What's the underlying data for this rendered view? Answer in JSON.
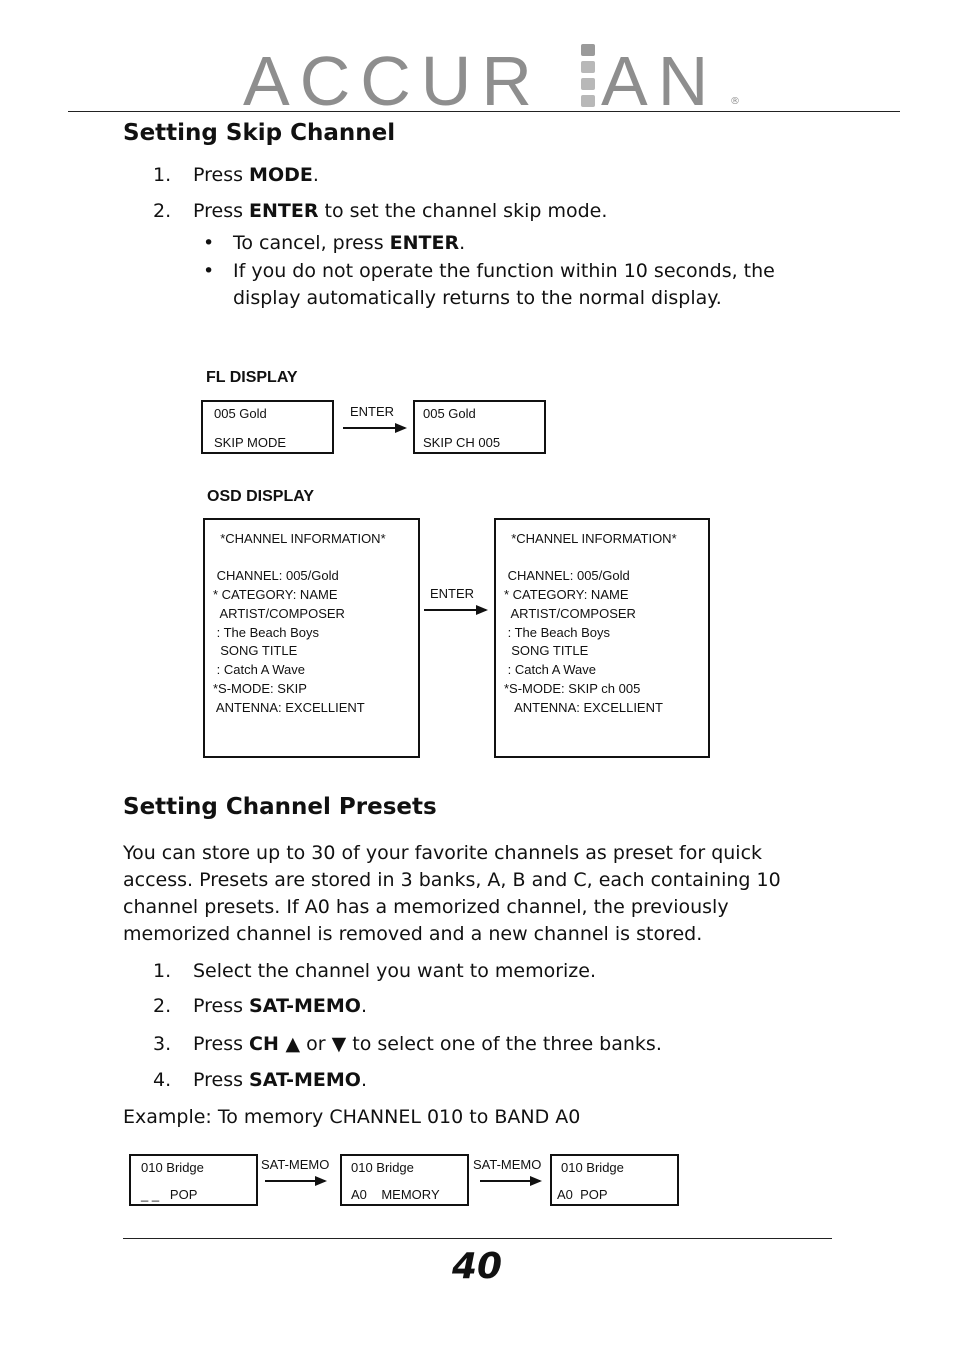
{
  "brand": {
    "name": "ACCUR",
    "name_tail": "AN",
    "registered": "®",
    "bar_colors": [
      "#9a9a9a",
      "#b8b8b8",
      "#b8b8b8",
      "#b8b8b8"
    ]
  },
  "section1": {
    "title": "Setting Skip Channel",
    "steps": [
      {
        "num": "1.",
        "pre": "Press ",
        "bold": "MODE",
        "post": "."
      },
      {
        "num": "2.",
        "pre": "Press ",
        "bold": "ENTER",
        "post": " to set the channel skip mode."
      }
    ],
    "bullets": [
      {
        "pre": "To cancel, press ",
        "bold": "ENTER",
        "post": "."
      },
      {
        "pre": "If you do not operate the function within 10 seconds, the display automatically returns to the normal display.",
        "bold": "",
        "post": ""
      }
    ],
    "bullet_char": "•",
    "fl_display": {
      "label": "FL DISPLAY",
      "arrow_label": "ENTER",
      "before": [
        "005 Gold",
        "SKIP MODE"
      ],
      "after": [
        "005 Gold",
        "SKIP CH 005"
      ]
    },
    "osd_display": {
      "label": "OSD DISPLAY",
      "arrow_label": "ENTER",
      "before": [
        "  *CHANNEL INFORMATION*",
        "",
        " CHANNEL: 005/Gold",
        "* CATEGORY: NAME",
        "  ARTIST/COMPOSER",
        " : The Beach Boys",
        "  SONG TITLE",
        " : Catch A Wave",
        "*S-MODE: SKIP",
        " ANTENNA: EXCELLIENT"
      ],
      "after": [
        "  *CHANNEL INFORMATION*",
        "",
        " CHANNEL: 005/Gold",
        "* CATEGORY: NAME",
        "  ARTIST/COMPOSER",
        " : The Beach Boys",
        "  SONG TITLE",
        " : Catch A Wave",
        "*S-MODE: SKIP ch 005",
        "   ANTENNA: EXCELLIENT"
      ]
    }
  },
  "section2": {
    "title": "Setting Channel Presets",
    "paragraph": "You can store up to 30 of your favorite channels as preset for quick access. Presets are stored in 3 banks, A, B and C, each containing 10 channel presets. If A0 has a memorized channel, the previously memorized channel is removed and a new channel is stored.",
    "steps": [
      {
        "num": "1.",
        "pre": "Select the channel you want to memorize.",
        "bold": "",
        "post": ""
      },
      {
        "num": "2.",
        "pre": "Press ",
        "bold": "SAT-MEMO",
        "post": "."
      },
      {
        "num": "3.",
        "pre": "Press ",
        "bold": "CH ▲",
        "post": " or ▼ to select one of the three banks."
      },
      {
        "num": "4.",
        "pre": "Press ",
        "bold": "SAT-MEMO",
        "post": "."
      }
    ],
    "example": "Example: To memory CHANNEL 010 to BAND A0",
    "example_flow": {
      "arrow_label": "SAT-MEMO",
      "boxes": [
        [
          "010 Bridge",
          "_ _   POP"
        ],
        [
          "010 Bridge",
          "A0    MEMORY"
        ],
        [
          "010 Bridge",
          "A0  POP"
        ]
      ]
    }
  },
  "footer": {
    "page_number": "40"
  }
}
